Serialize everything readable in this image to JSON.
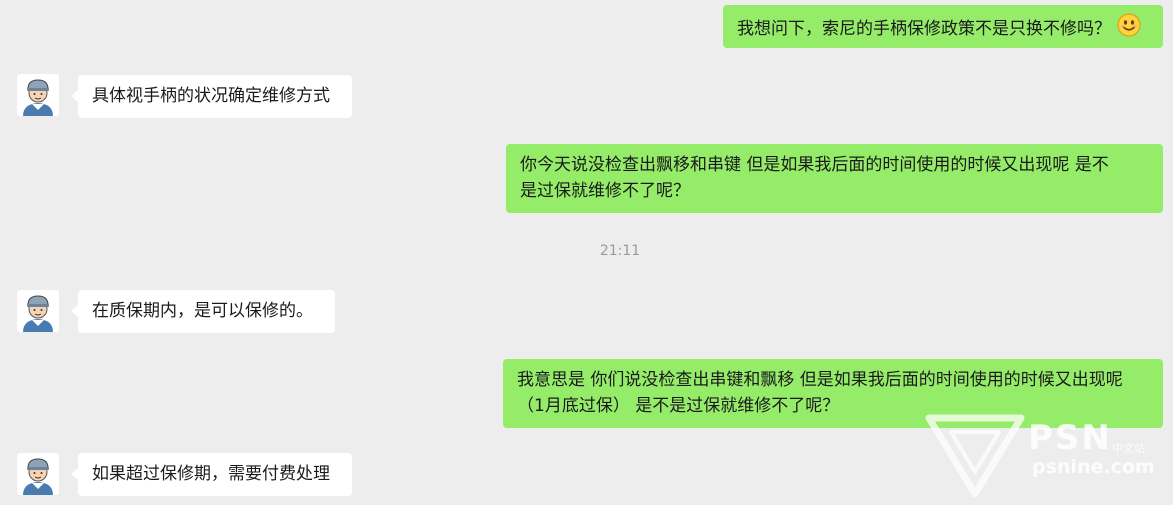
{
  "messages": [
    {
      "side": "right",
      "text": "我想问下，索尼的手柄保修政策不是只换不修吗？",
      "emoji": "smile-emoji"
    },
    {
      "side": "left",
      "text": "具体视手柄的状况确定维修方式"
    },
    {
      "side": "right",
      "line1": "你今天说没检查出飘移和串键    但是如果我后面的时间使用的时候又出现呢  是不",
      "line2": "是过保就维修不了呢？"
    },
    {
      "side": "left",
      "text": "在质保期内，是可以保修的。"
    },
    {
      "side": "right",
      "line1": "我意思是 你们说没检查出串键和飘移  但是如果我后面的时间使用的时候又出现呢",
      "line2": "（1月底过保）   是不是过保就维修不了呢？"
    },
    {
      "side": "left",
      "text": "如果超过保修期，需要付费处理"
    }
  ],
  "timestamp": "21:11",
  "watermark": {
    "brand": "PSN",
    "cn": "中文站",
    "site": "psnine.com"
  },
  "colors": {
    "background": "#ededed",
    "my_bubble": "#95ec69",
    "their_bubble": "#ffffff",
    "timestamp": "#9b9b9b"
  }
}
